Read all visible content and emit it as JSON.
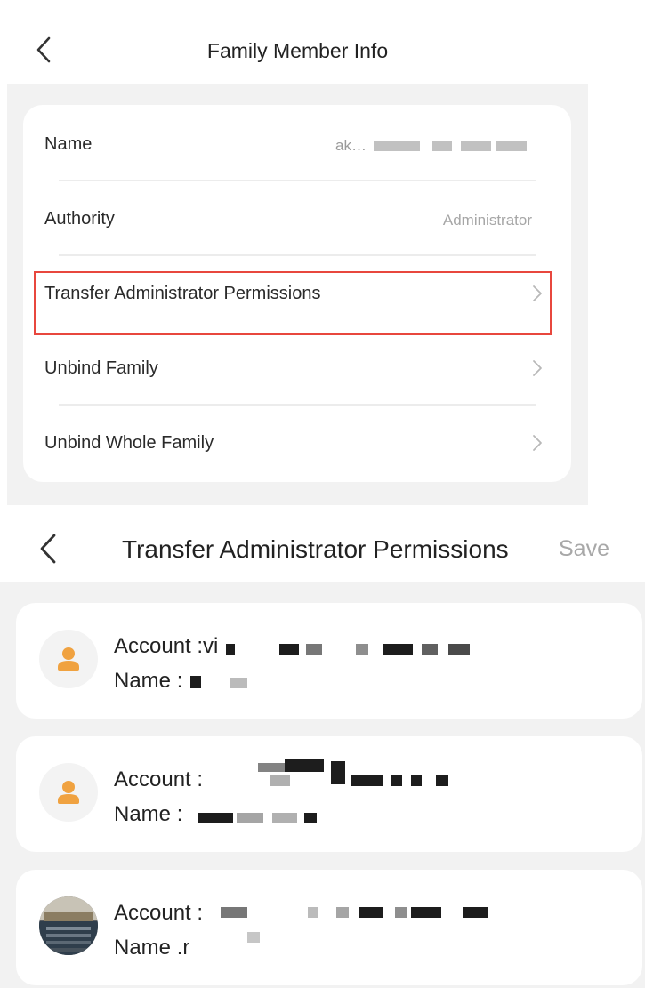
{
  "member_info": {
    "title": "Family Member Info",
    "rows": {
      "name": {
        "label": "Name",
        "value": "ak…"
      },
      "authority": {
        "label": "Authority",
        "value": "Administrator"
      },
      "transfer": {
        "label": "Transfer Administrator Permissions"
      },
      "unbind": {
        "label": "Unbind Family"
      },
      "unbind_whole": {
        "label": "Unbind Whole Family"
      }
    },
    "highlight_color": "#e8473e"
  },
  "transfer_screen": {
    "title": "Transfer Administrator Permissions",
    "save_label": "Save",
    "accounts": [
      {
        "account_label": "Account :vi",
        "name_label": "Name :",
        "avatar": "person-icon"
      },
      {
        "account_label": "Account :",
        "name_label": "Name :",
        "avatar": "person-icon"
      },
      {
        "account_label": "Account :",
        "name_label": "Name .r",
        "avatar": "photo-avatar"
      }
    ],
    "accent_color": "#f0a240"
  }
}
